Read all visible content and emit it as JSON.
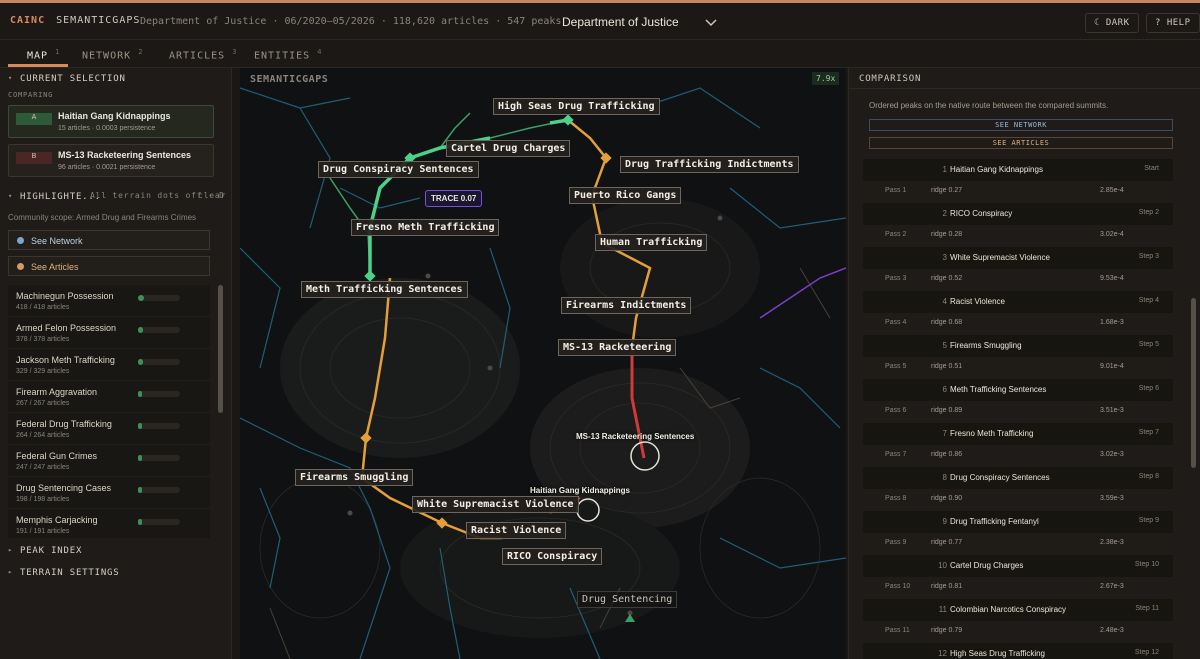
{
  "topbar": {
    "brand": "CAINC",
    "product": "SEMANTICGAPS",
    "meta": "Department of Justice · 06/2020–05/2026 · 118,620 articles · 547 peaks",
    "dataset": "Department of Justice",
    "dark_label": "DARK",
    "help_label": "HELP"
  },
  "tabs": [
    {
      "label": "MAP",
      "num": "1"
    },
    {
      "label": "NETWORK",
      "num": "2"
    },
    {
      "label": "ARTICLES",
      "num": "3"
    },
    {
      "label": "ENTITIES",
      "num": "4"
    }
  ],
  "left": {
    "current_selection": "CURRENT SELECTION",
    "comparing": "COMPARING",
    "compare": [
      {
        "badge": "A",
        "title": "Haitian Gang Kidnappings",
        "sub": "15 articles · 0.0003 persistence"
      },
      {
        "badge": "B",
        "title": "MS-13 Racketeering Sentences",
        "sub": "96 articles · 0.0021 persistence"
      }
    ],
    "highlights": "HIGHLIGHTE...",
    "highlight_note": "All terrain dots off · D shows",
    "clear": "clear",
    "scope": "Community scope: Armed Drug and Firearms Crimes",
    "see_network": "See Network",
    "see_articles": "See Articles",
    "items": [
      {
        "name": "Machinegun Possession",
        "count": "418 / 418 articles"
      },
      {
        "name": "Armed Felon Possession",
        "count": "378 / 378 articles"
      },
      {
        "name": "Jackson Meth Trafficking",
        "count": "329 / 329 articles"
      },
      {
        "name": "Firearm Aggravation",
        "count": "267 / 267 articles"
      },
      {
        "name": "Federal Drug Trafficking",
        "count": "264 / 264 articles"
      },
      {
        "name": "Federal Gun Crimes",
        "count": "247 / 247 articles"
      },
      {
        "name": "Drug Sentencing Cases",
        "count": "198 / 198 articles"
      },
      {
        "name": "Memphis Carjacking",
        "count": "191 / 191 articles"
      }
    ],
    "peak_index": "PEAK INDEX",
    "terrain_settings": "TERRAIN SETTINGS"
  },
  "map": {
    "label": "SEMANTICGAPS",
    "zoom": "7.9x",
    "trace": "TRACE 0.07",
    "peaks": [
      "High Seas Drug Trafficking",
      "Cartel Drug Charges",
      "Drug Trafficking Indictments",
      "Drug Conspiracy Sentences",
      "Puerto Rico Gangs",
      "Fresno Meth Trafficking",
      "Human Trafficking",
      "Meth Trafficking Sentences",
      "Firearms Indictments",
      "MS-13 Racketeering",
      "Firearms Smuggling",
      "White Supremacist Violence",
      "Racist Violence",
      "RICO Conspiracy",
      "Drug Sentencing"
    ],
    "plain": [
      "MS-13 Racketeering Sentences",
      "Haitian Gang Kidnappings"
    ]
  },
  "right": {
    "title": "COMPARISON",
    "desc": "Ordered peaks on the native route between the compared summits.",
    "see_network": "SEE NETWORK",
    "see_articles": "SEE ARTICLES",
    "peaks": [
      {
        "num": "1",
        "name": "Haitian Gang Kidnappings",
        "step": "Start"
      },
      {
        "num": "2",
        "name": "RICO Conspiracy",
        "step": "Step 2"
      },
      {
        "num": "3",
        "name": "White Supremacist Violence",
        "step": "Step 3"
      },
      {
        "num": "4",
        "name": "Racist Violence",
        "step": "Step 4"
      },
      {
        "num": "5",
        "name": "Firearms Smuggling",
        "step": "Step 5"
      },
      {
        "num": "6",
        "name": "Meth Trafficking Sentences",
        "step": "Step 6"
      },
      {
        "num": "7",
        "name": "Fresno Meth Trafficking",
        "step": "Step 7"
      },
      {
        "num": "8",
        "name": "Drug Conspiracy Sentences",
        "step": "Step 8"
      },
      {
        "num": "9",
        "name": "Drug Trafficking Fentanyl",
        "step": "Step 9"
      },
      {
        "num": "10",
        "name": "Cartel Drug Charges",
        "step": "Step 10"
      },
      {
        "num": "11",
        "name": "Colombian Narcotics Conspiracy",
        "step": "Step 11"
      },
      {
        "num": "12",
        "name": "High Seas Drug Trafficking",
        "step": "Step 12"
      }
    ],
    "passes": [
      {
        "label": "Pass 1",
        "ridge": "ridge 0.27",
        "val": "2.85e-4"
      },
      {
        "label": "Pass 2",
        "ridge": "ridge 0.28",
        "val": "3.02e-4"
      },
      {
        "label": "Pass 3",
        "ridge": "ridge 0.52",
        "val": "9.53e-4"
      },
      {
        "label": "Pass 4",
        "ridge": "ridge 0.68",
        "val": "1.68e-3"
      },
      {
        "label": "Pass 5",
        "ridge": "ridge 0.51",
        "val": "9.01e-4"
      },
      {
        "label": "Pass 6",
        "ridge": "ridge 0.89",
        "val": "3.51e-3"
      },
      {
        "label": "Pass 7",
        "ridge": "ridge 0.86",
        "val": "3.02e-3"
      },
      {
        "label": "Pass 8",
        "ridge": "ridge 0.90",
        "val": "3.59e-3"
      },
      {
        "label": "Pass 9",
        "ridge": "ridge 0.77",
        "val": "2.38e-3"
      },
      {
        "label": "Pass 10",
        "ridge": "ridge 0.81",
        "val": "2.67e-3"
      },
      {
        "label": "Pass 11",
        "ridge": "ridge 0.79",
        "val": "2.48e-3"
      }
    ]
  }
}
